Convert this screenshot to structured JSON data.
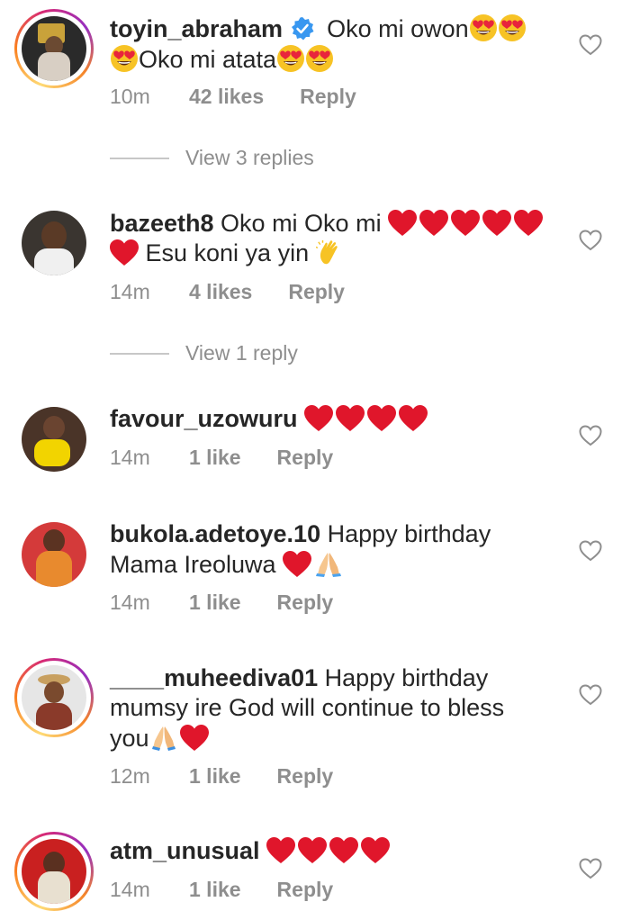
{
  "comments": [
    {
      "username": "toyin_abraham",
      "verified": true,
      "text1": " Oko mi owon",
      "text2": "Oko mi atata",
      "time": "10m",
      "likes": "42 likes",
      "reply": "Reply"
    },
    {
      "username": "bazeeth8",
      "text1": " Oko mi Oko mi ",
      "text2": " Esu koni ya yin ",
      "time": "14m",
      "likes": "4 likes",
      "reply": "Reply"
    },
    {
      "username": "favour_uzowuru",
      "text1": " ",
      "time": "14m",
      "likes": "1 like",
      "reply": "Reply"
    },
    {
      "username": "bukola.adetoye.10",
      "text1": " Happy birthday",
      "text2": "Mama Ireoluwa ",
      "time": "14m",
      "likes": "1 like",
      "reply": "Reply"
    },
    {
      "username": "____muheediva01",
      "text1": " Happy birthday",
      "text2": "mumsy ire God will continue to bless",
      "text3": "you",
      "time": "12m",
      "likes": "1 like",
      "reply": "Reply"
    },
    {
      "username": "atm_unusual",
      "text1": " ",
      "time": "14m",
      "likes": "1 like",
      "reply": "Reply"
    }
  ],
  "view_replies": [
    {
      "label": "View 3 replies"
    },
    {
      "label": "View 1 reply"
    }
  ]
}
